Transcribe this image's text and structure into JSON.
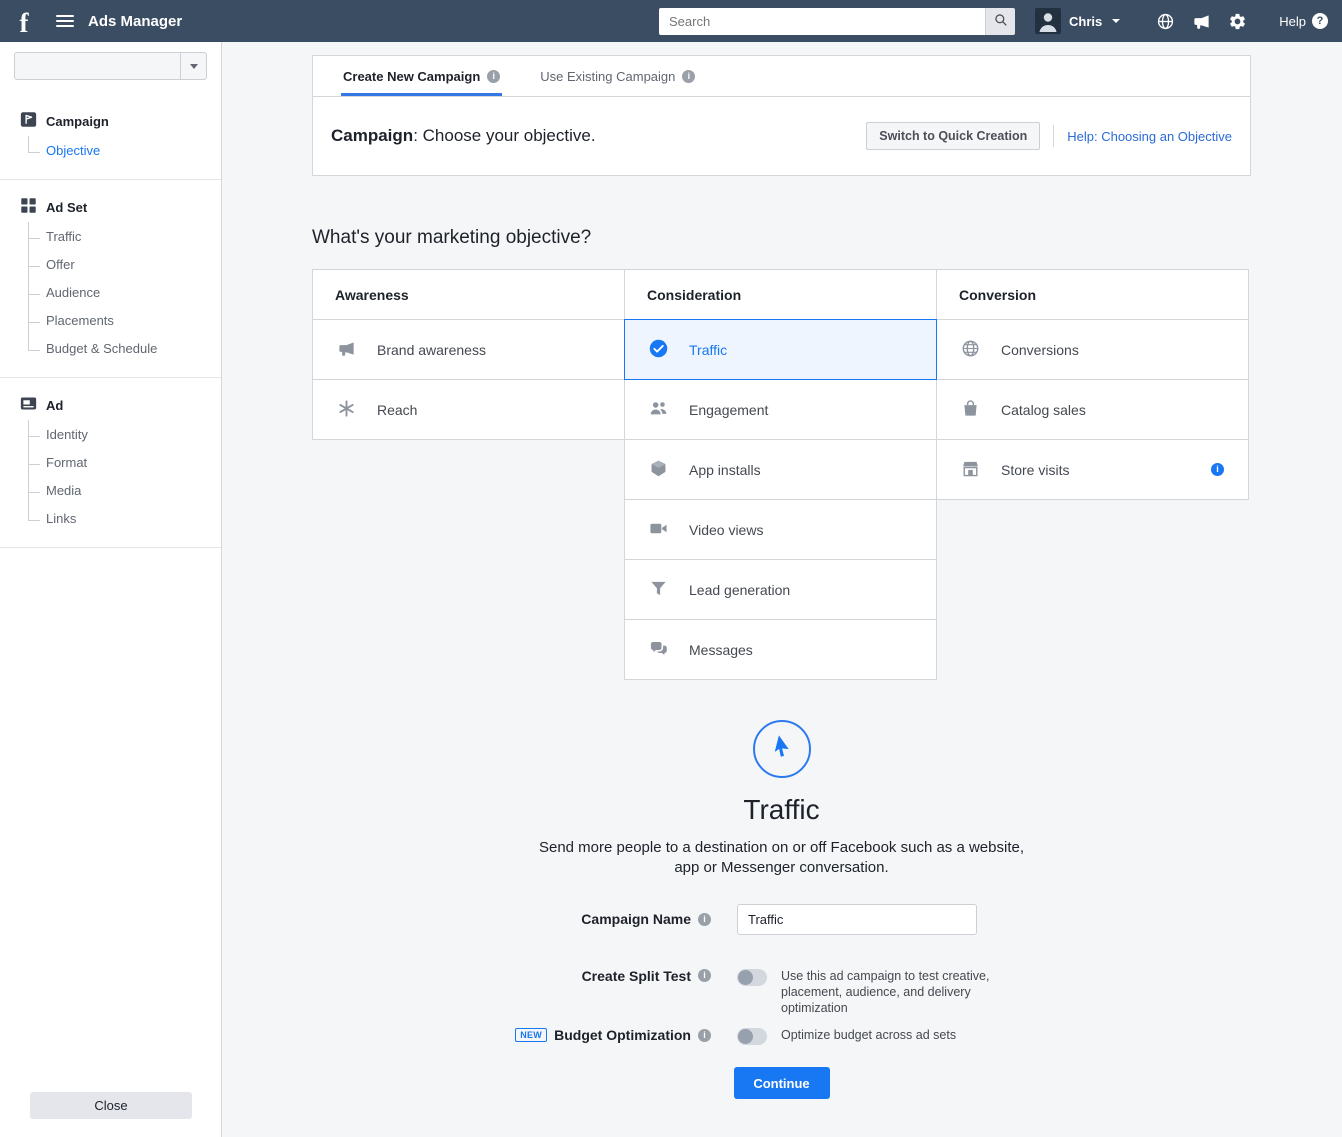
{
  "colors": {
    "topbar_bg": "#3b4d63",
    "accent_blue": "#1877f2",
    "link_blue": "#2a6bd8",
    "selected_cell_bg": "#eef5fe",
    "border_gray": "#d3d6db",
    "text_dark": "#1d2129",
    "text_gray": "#606770"
  },
  "icons": {
    "fb_logo_glyph": "f",
    "info_glyph": "i",
    "question_glyph": "?"
  },
  "topbar": {
    "title": "Ads Manager",
    "search_placeholder": "Search",
    "user_name": "Chris",
    "help_label": "Help",
    "icon_names": [
      "globe-icon",
      "megaphone-icon",
      "gear-icon"
    ]
  },
  "sidebar": {
    "account_select_value": "",
    "sections": [
      {
        "label": "Campaign",
        "icon": "campaign-flag-icon",
        "items": [
          {
            "label": "Objective",
            "active": true
          }
        ]
      },
      {
        "label": "Ad Set",
        "icon": "adset-grid-icon",
        "items": [
          {
            "label": "Traffic",
            "active": false
          },
          {
            "label": "Offer",
            "active": false
          },
          {
            "label": "Audience",
            "active": false
          },
          {
            "label": "Placements",
            "active": false
          },
          {
            "label": "Budget & Schedule",
            "active": false
          }
        ]
      },
      {
        "label": "Ad",
        "icon": "ad-card-icon",
        "items": [
          {
            "label": "Identity",
            "active": false
          },
          {
            "label": "Format",
            "active": false
          },
          {
            "label": "Media",
            "active": false
          },
          {
            "label": "Links",
            "active": false
          }
        ]
      }
    ],
    "close_label": "Close"
  },
  "tabs": [
    {
      "label": "Create New Campaign",
      "active": true
    },
    {
      "label": "Use Existing Campaign",
      "active": false
    }
  ],
  "campaign_header": {
    "label_bold": "Campaign",
    "label_rest": ": Choose your objective.",
    "quick_creation_button": "Switch to Quick Creation",
    "help_link": "Help: Choosing an Objective"
  },
  "objective_question": "What's your marketing objective?",
  "objective_columns": [
    {
      "header": "Awareness",
      "items": [
        {
          "label": "Brand awareness",
          "icon": "megaphone-icon",
          "selected": false
        },
        {
          "label": "Reach",
          "icon": "reach-burst-icon",
          "selected": false
        }
      ]
    },
    {
      "header": "Consideration",
      "items": [
        {
          "label": "Traffic",
          "icon": "check-circle-icon",
          "selected": true
        },
        {
          "label": "Engagement",
          "icon": "people-icon",
          "selected": false
        },
        {
          "label": "App installs",
          "icon": "cube-icon",
          "selected": false
        },
        {
          "label": "Video views",
          "icon": "video-camera-icon",
          "selected": false
        },
        {
          "label": "Lead generation",
          "icon": "funnel-icon",
          "selected": false
        },
        {
          "label": "Messages",
          "icon": "chat-bubbles-icon",
          "selected": false
        }
      ]
    },
    {
      "header": "Conversion",
      "items": [
        {
          "label": "Conversions",
          "icon": "globe-grid-icon",
          "selected": false
        },
        {
          "label": "Catalog sales",
          "icon": "shopping-bag-icon",
          "selected": false
        },
        {
          "label": "Store visits",
          "icon": "storefront-icon",
          "selected": false,
          "info": true
        }
      ]
    }
  ],
  "detail": {
    "selected_icon": "cursor-arrow-icon",
    "title": "Traffic",
    "description": "Send more people to a destination on or off Facebook such as a website, app or Messenger conversation.",
    "campaign_name_label": "Campaign Name",
    "campaign_name_value": "Traffic",
    "split_test_label": "Create Split Test",
    "split_test_state": "off",
    "split_test_desc": "Use this ad campaign to test creative, placement, audience, and delivery optimization",
    "new_badge": "NEW",
    "budget_opt_label": "Budget Optimization",
    "budget_opt_state": "off",
    "budget_opt_desc": "Optimize budget across ad sets",
    "continue_label": "Continue"
  }
}
